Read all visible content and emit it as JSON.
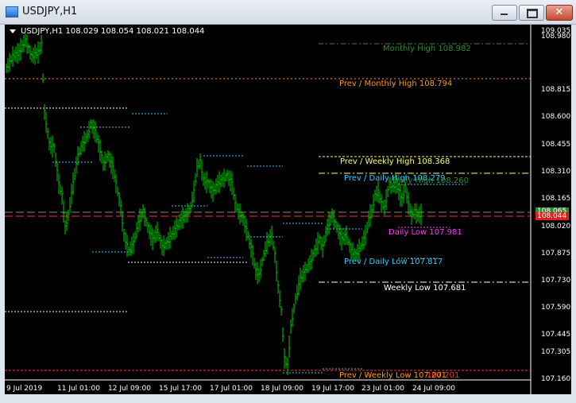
{
  "window": {
    "title": "USDJPY,H1"
  },
  "chart": {
    "symbol_info": "USDJPY,H1  108.029 108.054 108.021 108.044",
    "price_scale": [
      "109.035",
      "108.980",
      "108.815",
      "108.600",
      "108.455",
      "108.310",
      "108.165",
      "108.020",
      "107.875",
      "107.730",
      "107.590",
      "107.445",
      "107.305",
      "107.160"
    ],
    "time_scale": [
      "9 Jul 2019",
      "11 Jul 01:00",
      "12 Jul 09:00",
      "15 Jul 17:00",
      "17 Jul 01:00",
      "18 Jul 09:00",
      "19 Jul 17:00",
      "23 Jul 01:00",
      "24 Jul 09:00"
    ],
    "current_price_tag": "108.044",
    "ask_price_tag": "108.065",
    "levels": {
      "monthly_high": "Monthly High 108.982",
      "prev_monthly_high": "Prev / Monthly High 108.794",
      "prev_weekly_high": "Prev / Weekly High 108.368",
      "prev_daily_high": "Prev / Daily High 108.279",
      "daily_high": "Daily High 108.260",
      "daily_low": "Daily Low 107.981",
      "prev_daily_low": "Prev / Daily Low 107.817",
      "weekly_low": "Weekly Low 107.681",
      "prev_weekly_low": "Prev / Weekly Low 107.201",
      "monthly_low": "107.201"
    },
    "colors": {
      "candle": "#00c800",
      "monthly": "#2e8b2e",
      "prev_monthly": "#ff9900",
      "weekly": "#ffff66",
      "daily_prev": "#33ccff",
      "daily_low": "#ff33ff",
      "weekly_low": "#ffffff",
      "prev_weekly_low": "#ff9900",
      "current": "#ff3333"
    }
  }
}
